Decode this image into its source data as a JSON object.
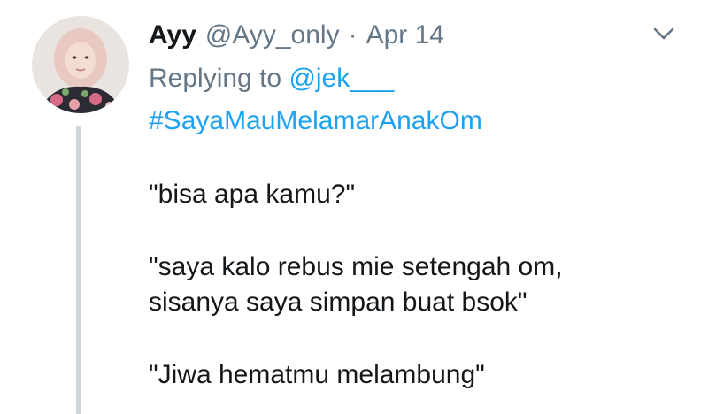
{
  "tweet": {
    "display_name": "Ayy",
    "handle": "@Ayy_only",
    "separator": "·",
    "date": "Apr 14",
    "menu_icon": "chevron-down-icon",
    "avatar_icon": "avatar",
    "replying_prefix": "Replying to",
    "replying_to": "@jek___",
    "hashtag": "#SayaMauMelamarAnakOm",
    "paragraphs": [
      {
        "lines": [
          "\"bisa apa kamu?\""
        ]
      },
      {
        "lines": [
          "\"saya kalo rebus mie setengah om,",
          "sisanya saya simpan buat bsok\""
        ]
      },
      {
        "lines": [
          "\"Jiwa hematmu melambung\""
        ]
      }
    ]
  },
  "colors": {
    "text": "#14171a",
    "muted": "#657786",
    "link": "#1da1f2",
    "thread_line": "#ccd6dd"
  }
}
